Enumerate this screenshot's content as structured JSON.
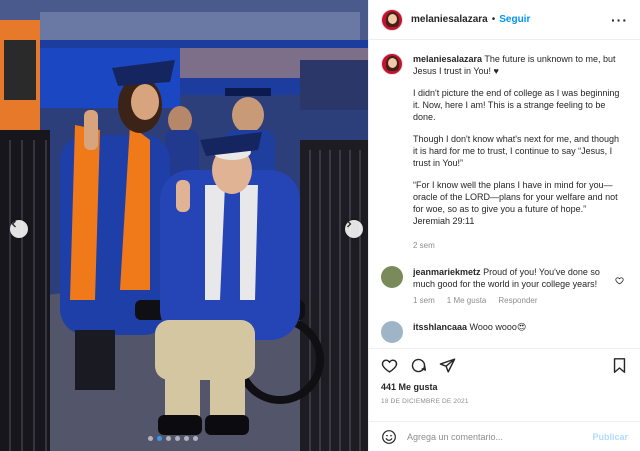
{
  "colors": {
    "brand_blue": "#0095f6",
    "gown_blue": "#1f3fa8",
    "stole_orange": "#f07a1a",
    "muted": "#8e8e8e"
  },
  "header": {
    "username": "melaniesalazara",
    "separator": "•",
    "follow_label": "Seguir",
    "more_icon": "more-horizontal-icon"
  },
  "caption": {
    "username": "melaniesalazara",
    "first_line": "The future is unknown to me, but Jesus I trust in You! ♥",
    "paragraphs": [
      "I didn't picture the end of college as I was beginning it. Now, here I am! This is a strange feeling to be done.",
      "Though I don't know what's next for me, and though it is hard for me to trust, I continue to say “Jesus, I trust in You!”",
      "“For I know well the plans I have in mind for you—oracle of the LORD—plans for your welfare and not for woe, so as to give you a future of hope.” Jeremiah 29:11"
    ],
    "time": "2 sem"
  },
  "comments": [
    {
      "username": "jeanmariekmetz",
      "text": "Proud of you! You've done so much good for the world in your college years!",
      "time": "1 sem",
      "likes": "1 Me gusta",
      "reply": "Responder"
    },
    {
      "username": "itsshlancaaa",
      "text": "Wooo wooo😍"
    }
  ],
  "actions": {
    "icons": [
      "heart-icon",
      "comment-icon",
      "share-icon",
      "bookmark-icon"
    ],
    "likes": "441 Me gusta",
    "date": "18 DE DICIEMBRE DE 2021"
  },
  "add_comment": {
    "placeholder": "Agrega un comentario...",
    "publish": "Publicar",
    "emoji_icon": "emoji-icon"
  },
  "carousel": {
    "total_slides": 6,
    "active_slide": 1,
    "prev_icon": "chevron-left-icon",
    "next_icon": "chevron-right-icon"
  }
}
